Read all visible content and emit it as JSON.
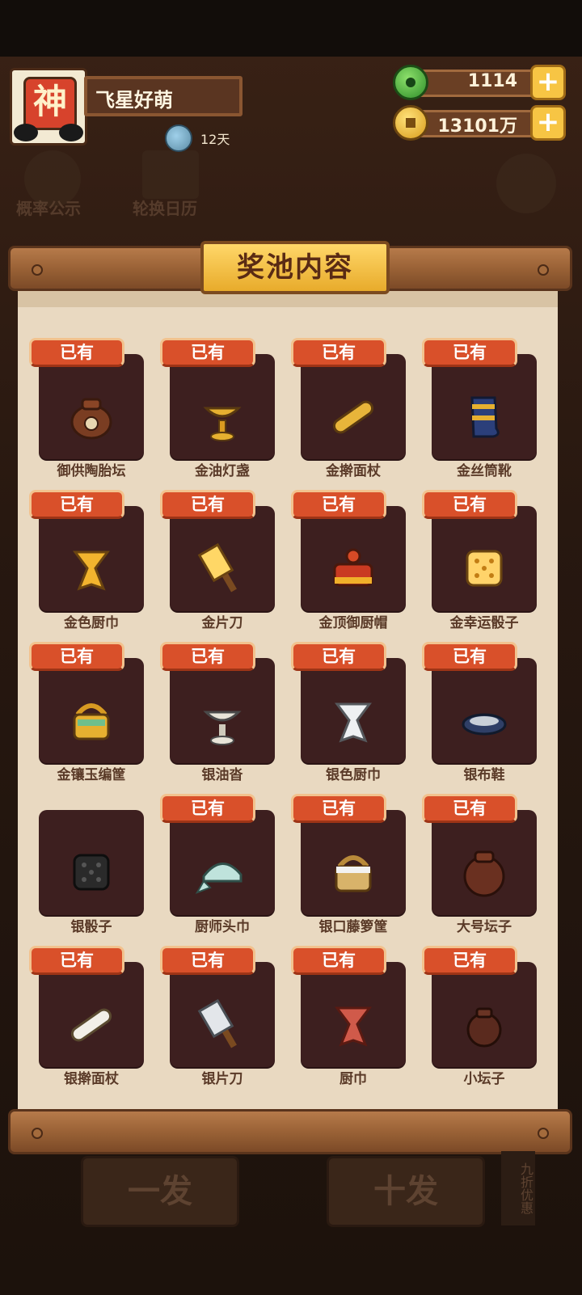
{
  "header": {
    "avatar_char": "神",
    "username": "飞星好萌",
    "days": "12天",
    "jade": "1114",
    "coins": "13101万"
  },
  "background": {
    "probability": "概率公示",
    "calendar": "轮换日历",
    "single": "一发",
    "ten": "十发",
    "discount": "九折优惠"
  },
  "panel": {
    "title": "奖池内容"
  },
  "owned_label": "已有",
  "items": [
    {
      "name": "御供陶胎坛",
      "owned": true,
      "icon": "clay-jar-icon"
    },
    {
      "name": "金油灯盏",
      "owned": true,
      "icon": "gold-oil-lamp-icon"
    },
    {
      "name": "金擀面杖",
      "owned": true,
      "icon": "gold-rolling-pin-icon"
    },
    {
      "name": "金丝筒靴",
      "owned": true,
      "icon": "gold-boot-icon"
    },
    {
      "name": "金色厨巾",
      "owned": true,
      "icon": "gold-scarf-icon"
    },
    {
      "name": "金片刀",
      "owned": true,
      "icon": "gold-cleaver-icon"
    },
    {
      "name": "金顶御厨帽",
      "owned": true,
      "icon": "gold-chef-hat-icon"
    },
    {
      "name": "金幸运骰子",
      "owned": true,
      "icon": "gold-dice-icon"
    },
    {
      "name": "金镶玉编筐",
      "owned": true,
      "icon": "gold-basket-icon"
    },
    {
      "name": "银油沓",
      "owned": true,
      "icon": "silver-oil-lamp-icon"
    },
    {
      "name": "银色厨巾",
      "owned": true,
      "icon": "silver-scarf-icon"
    },
    {
      "name": "银布鞋",
      "owned": true,
      "icon": "silver-shoe-icon"
    },
    {
      "name": "银骰子",
      "owned": false,
      "icon": "silver-dice-icon"
    },
    {
      "name": "厨师头巾",
      "owned": true,
      "icon": "chef-headscarf-icon"
    },
    {
      "name": "银口藤箩筐",
      "owned": true,
      "icon": "silver-basket-icon"
    },
    {
      "name": "大号坛子",
      "owned": true,
      "icon": "large-jar-icon"
    },
    {
      "name": "银擀面杖",
      "owned": true,
      "icon": "silver-rolling-pin-icon"
    },
    {
      "name": "银片刀",
      "owned": true,
      "icon": "silver-cleaver-icon"
    },
    {
      "name": "厨巾",
      "owned": true,
      "icon": "red-scarf-icon"
    },
    {
      "name": "小坛子",
      "owned": true,
      "icon": "small-jar-icon"
    }
  ]
}
